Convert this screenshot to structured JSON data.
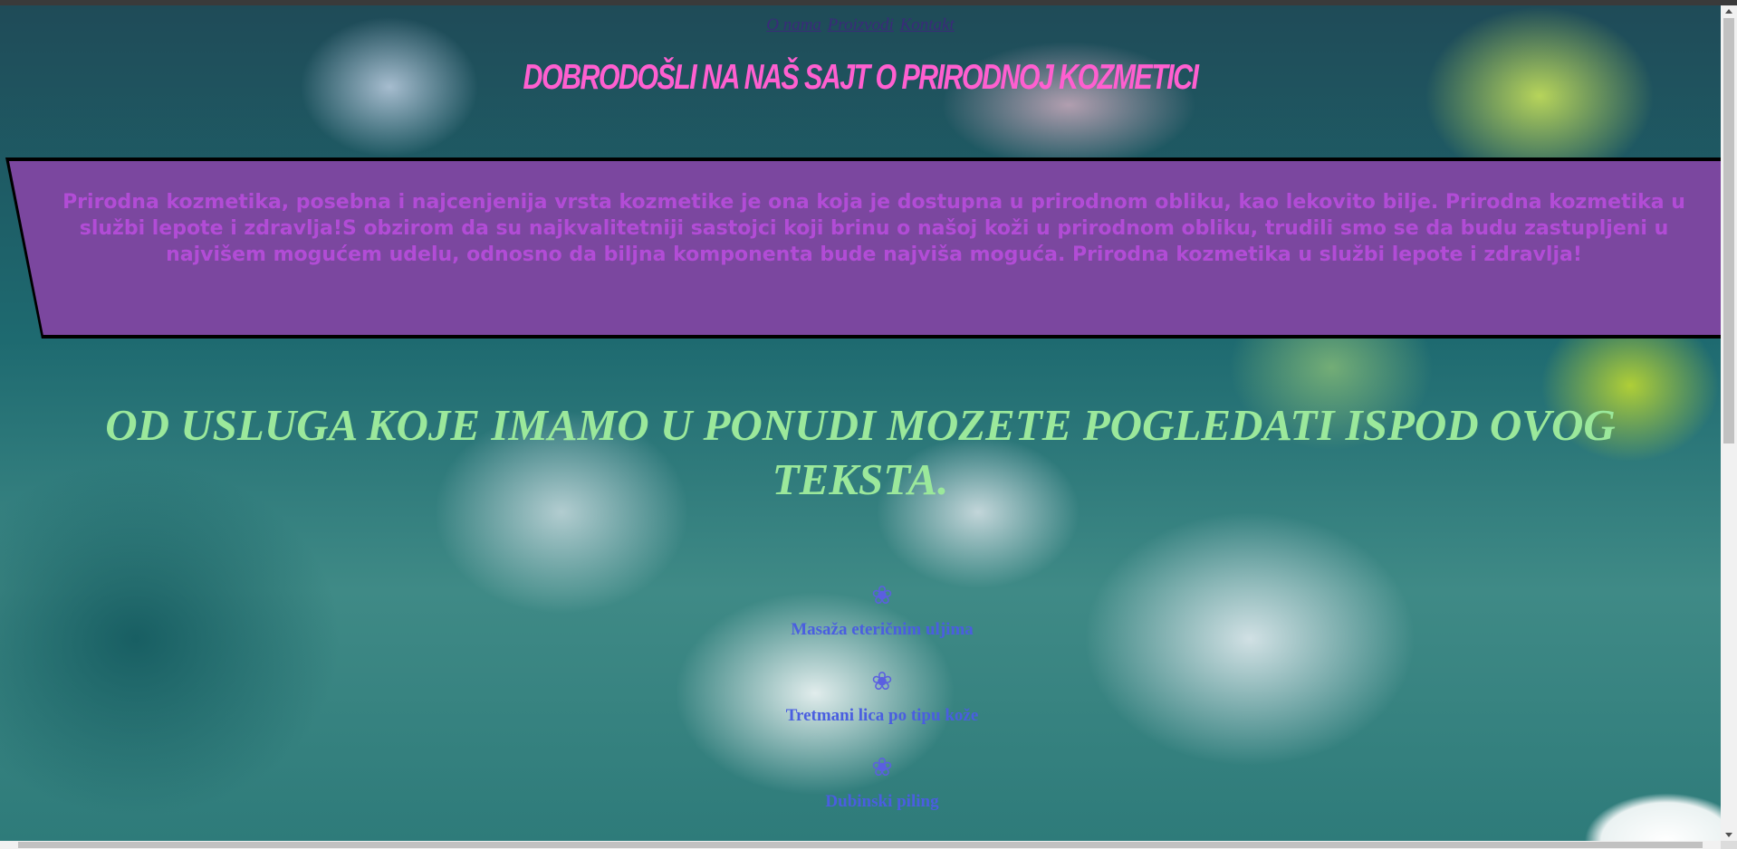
{
  "nav": {
    "links": [
      "O nama",
      "Proizvodi",
      "Kontakt"
    ]
  },
  "welcome": {
    "title": "DOBRODOŠLI NA NAŠ SAJT O PRIRODNOJ KOZMETICI"
  },
  "intro": {
    "text": "Prirodna kozmetika, posebna i najcenjenija vrsta kozmetike je ona koja je dostupna u prirodnom obliku, kao lekovito bilje. Prirodna kozmetika u službi lepote i zdravlja!S obzirom da su najkvalitetniji sastojci koji brinu o našoj koži u prirodnom obliku, trudili smo se da budu zastupljeni u najvišem mogućem udelu, odnosno da biljna komponenta bude najviša moguća. Prirodna kozmetika u službi lepote i zdravlja!"
  },
  "services": {
    "heading": "OD USLUGA KOJE IMAMO U PONUDI MOZETE POGLEDATI ISPOD OVOG TEKSTA.",
    "items": [
      {
        "icon": "flower-icon",
        "glyph": "❀",
        "label": "Masaža eteričnim uljima"
      },
      {
        "icon": "flower-icon",
        "glyph": "❀",
        "label": "Tretmani lica po tipu kože"
      },
      {
        "icon": "flower-icon",
        "glyph": "❀",
        "label": "Dubinski piling"
      }
    ]
  },
  "colors": {
    "welcome": "#ff5fd0",
    "intro_bg": "#7b479f",
    "intro_text": "#b24cd6",
    "heading": "#9be89b",
    "service": "#4a5ee0"
  }
}
